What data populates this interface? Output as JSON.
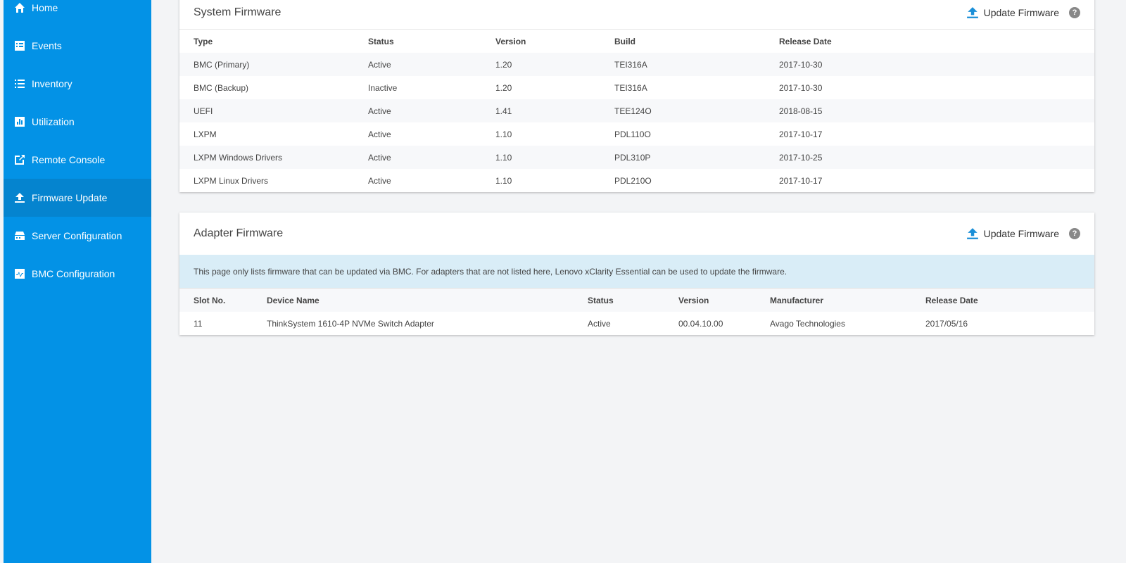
{
  "sidebar": {
    "items": [
      {
        "label": "Home",
        "icon": "home-icon"
      },
      {
        "label": "Events",
        "icon": "events-icon"
      },
      {
        "label": "Inventory",
        "icon": "inventory-icon"
      },
      {
        "label": "Utilization",
        "icon": "utilization-icon"
      },
      {
        "label": "Remote Console",
        "icon": "remote-console-icon"
      },
      {
        "label": "Firmware Update",
        "icon": "upload-icon",
        "active": true
      },
      {
        "label": "Server Configuration",
        "icon": "server-icon"
      },
      {
        "label": "BMC Configuration",
        "icon": "pulse-icon"
      }
    ]
  },
  "system_firmware": {
    "title": "System Firmware",
    "update_label": "Update Firmware",
    "help": "?",
    "columns": [
      "Type",
      "Status",
      "Version",
      "Build",
      "Release Date"
    ],
    "rows": [
      [
        "BMC (Primary)",
        "Active",
        "1.20",
        "TEI316A",
        "2017-10-30"
      ],
      [
        "BMC (Backup)",
        "Inactive",
        "1.20",
        "TEI316A",
        "2017-10-30"
      ],
      [
        "UEFI",
        "Active",
        "1.41",
        "TEE124O",
        "2018-08-15"
      ],
      [
        "LXPM",
        "Active",
        "1.10",
        "PDL110O",
        "2017-10-17"
      ],
      [
        "LXPM Windows Drivers",
        "Active",
        "1.10",
        "PDL310P",
        "2017-10-25"
      ],
      [
        "LXPM Linux Drivers",
        "Active",
        "1.10",
        "PDL210O",
        "2017-10-17"
      ]
    ]
  },
  "adapter_firmware": {
    "title": "Adapter Firmware",
    "update_label": "Update Firmware",
    "help": "?",
    "info": "This page only lists firmware that can be updated via BMC. For adapters that are not listed here, Lenovo xClarity Essential can be used to update the firmware.",
    "columns": [
      "Slot No.",
      "Device Name",
      "Status",
      "Version",
      "Manufacturer",
      "Release Date"
    ],
    "rows": [
      [
        "11",
        "ThinkSystem 1610-4P NVMe Switch Adapter",
        "Active",
        "00.04.10.00",
        "Avago Technologies",
        "2017/05/16"
      ]
    ]
  }
}
